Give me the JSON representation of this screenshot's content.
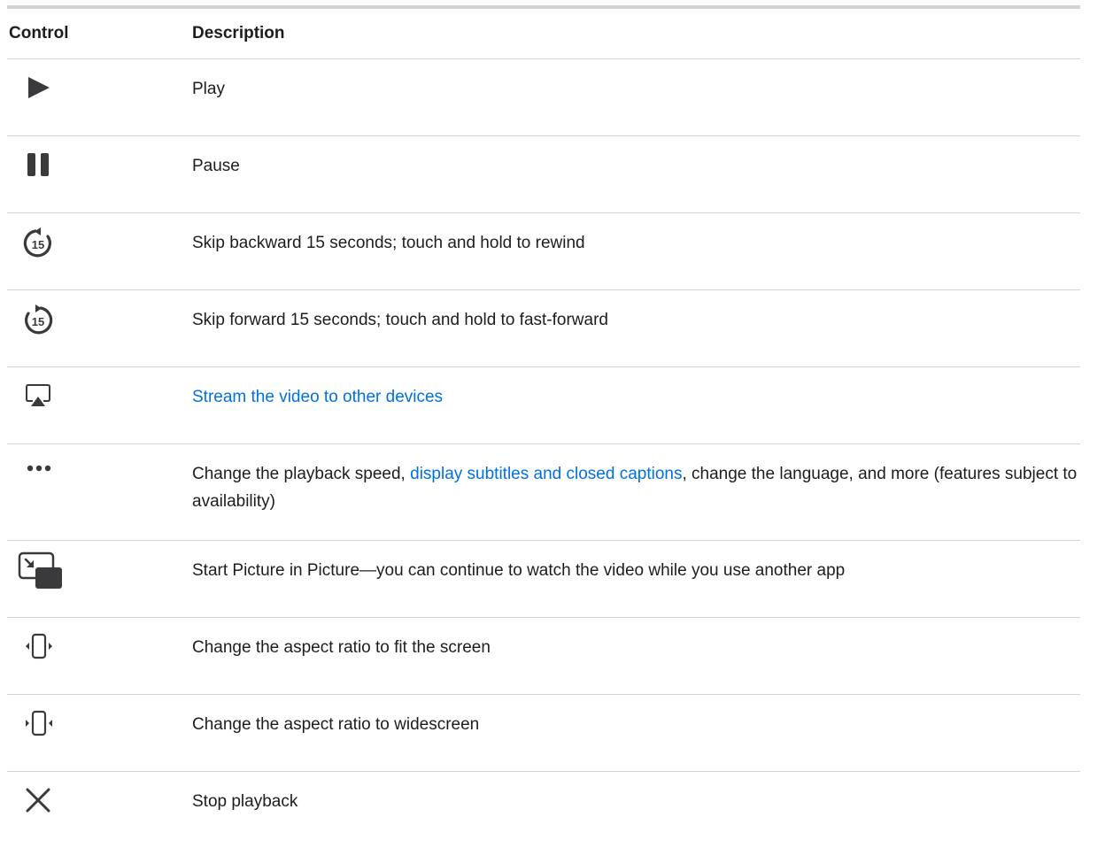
{
  "headers": {
    "control": "Control",
    "description": "Description"
  },
  "rows": [
    {
      "icon": "play-icon",
      "text": "Play"
    },
    {
      "icon": "pause-icon",
      "text": "Pause"
    },
    {
      "icon": "skip-backward-15-icon",
      "text": "Skip backward 15 seconds; touch and hold to rewind",
      "icon_label": "15"
    },
    {
      "icon": "skip-forward-15-icon",
      "text": "Skip forward 15 seconds; touch and hold to fast-forward",
      "icon_label": "15"
    },
    {
      "icon": "airplay-icon",
      "link_text": "Stream the video to other devices"
    },
    {
      "icon": "more-icon",
      "text_before": "Change the playback speed, ",
      "link_text": "display subtitles and closed captions",
      "text_after": ", change the language, and more (features subject to availability)"
    },
    {
      "icon": "picture-in-picture-icon",
      "text": "Start Picture in Picture—you can continue to watch the video while you use another app"
    },
    {
      "icon": "aspect-fit-icon",
      "text": "Change the aspect ratio to fit the screen"
    },
    {
      "icon": "aspect-widescreen-icon",
      "text": "Change the aspect ratio to widescreen"
    },
    {
      "icon": "close-icon",
      "text": "Stop playback"
    }
  ],
  "colors": {
    "link": "#0071e3",
    "text": "#1d1d1f",
    "icon": "#3a3a3c",
    "rule": "#d2d2d7"
  }
}
